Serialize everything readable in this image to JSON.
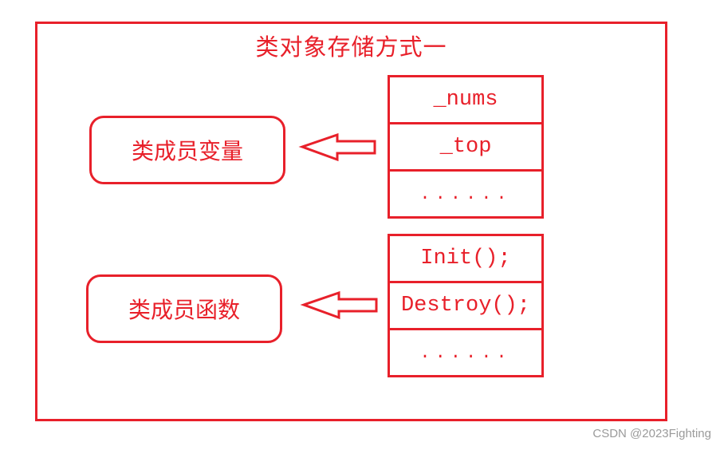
{
  "diagram": {
    "title": "类对象存储方式一",
    "accent_color": "#e8202a",
    "groups": [
      {
        "label": "类成员变量",
        "cells": [
          "_nums",
          "_top",
          "......"
        ]
      },
      {
        "label": "类成员函数",
        "cells": [
          "Init();",
          "Destroy();",
          "......"
        ]
      }
    ],
    "arrows": [
      {
        "from": "stack-variables",
        "to": "label-variables",
        "direction": "left"
      },
      {
        "from": "stack-functions",
        "to": "label-functions",
        "direction": "left"
      }
    ]
  },
  "watermark": "CSDN @2023Fighting"
}
